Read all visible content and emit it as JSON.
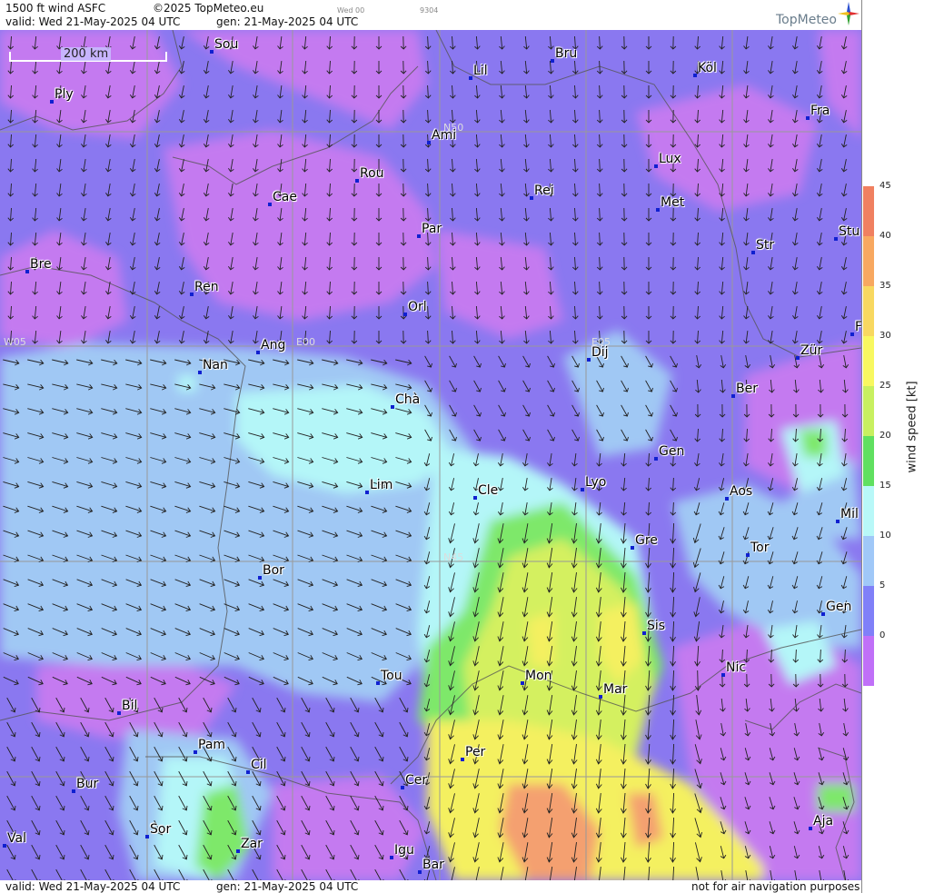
{
  "header": {
    "product": "1500 ft wind ASFC",
    "copyright": "©2025 TopMeteo.eu",
    "run_tag": "Wed 00",
    "code": "9304",
    "valid": "valid:  Wed  21-May-2025  04 UTC",
    "gen": "gen: 21-May-2025  04 UTC"
  },
  "logo": {
    "text": "TopMeteo"
  },
  "scale": {
    "label": "200 km"
  },
  "grid_labels": {
    "n50": "N50",
    "n45": "N45",
    "w05": "W05",
    "e00": "E00",
    "e05": "E05"
  },
  "cities": [
    {
      "name": "Sou"
    },
    {
      "name": "Ply"
    },
    {
      "name": "Lil"
    },
    {
      "name": "Bru"
    },
    {
      "name": "Köl"
    },
    {
      "name": "Fra"
    },
    {
      "name": "Ami"
    },
    {
      "name": "Lux"
    },
    {
      "name": "Rou"
    },
    {
      "name": "Cae"
    },
    {
      "name": "Rei"
    },
    {
      "name": "Met"
    },
    {
      "name": "Par"
    },
    {
      "name": "Bre"
    },
    {
      "name": "Str"
    },
    {
      "name": "Stu"
    },
    {
      "name": "Ren"
    },
    {
      "name": "Orl"
    },
    {
      "name": "Ang"
    },
    {
      "name": "Nan"
    },
    {
      "name": "Dij"
    },
    {
      "name": "Zür"
    },
    {
      "name": "Ber"
    },
    {
      "name": "Chà"
    },
    {
      "name": "Gen"
    },
    {
      "name": "Lim"
    },
    {
      "name": "Cle"
    },
    {
      "name": "Lyo"
    },
    {
      "name": "Aos"
    },
    {
      "name": "Mil"
    },
    {
      "name": "Gre"
    },
    {
      "name": "Tor"
    },
    {
      "name": "Bor"
    },
    {
      "name": "Gen"
    },
    {
      "name": "Sis"
    },
    {
      "name": "Nic"
    },
    {
      "name": "Tou"
    },
    {
      "name": "Mon"
    },
    {
      "name": "Mar"
    },
    {
      "name": "Bil"
    },
    {
      "name": "Pam"
    },
    {
      "name": "Cil"
    },
    {
      "name": "Per"
    },
    {
      "name": "Bur"
    },
    {
      "name": "Cer"
    },
    {
      "name": "Sor"
    },
    {
      "name": "Aja"
    },
    {
      "name": "Val"
    },
    {
      "name": "Zar"
    },
    {
      "name": "Igu"
    },
    {
      "name": "Bar"
    },
    {
      "name": "F"
    }
  ],
  "legend": {
    "title": "wind speed [kt]",
    "ticks": [
      "45",
      "40",
      "35",
      "30",
      "25",
      "20",
      "15",
      "10",
      "5",
      "0"
    ],
    "colors": [
      "#f08060",
      "#f8a860",
      "#f8d860",
      "#f8f860",
      "#c8f060",
      "#60e060",
      "#b8f8f8",
      "#a0c8f8",
      "#8080f8",
      "#c070f8"
    ]
  },
  "footer": {
    "valid": "valid:  Wed  21-May-2025  04 UTC",
    "gen": "gen: 21-May-2025  04 UTC",
    "disclaimer": "not for air navigation purposes"
  },
  "colors": {
    "calm": "#c47af0",
    "light": "#8a78f0",
    "moderate": "#a0c8f4",
    "fresh": "#b4f6f8",
    "strong": "#7ee86a",
    "stronger": "#d4f060",
    "yellow": "#f4f060",
    "orange": "#f4a070"
  }
}
